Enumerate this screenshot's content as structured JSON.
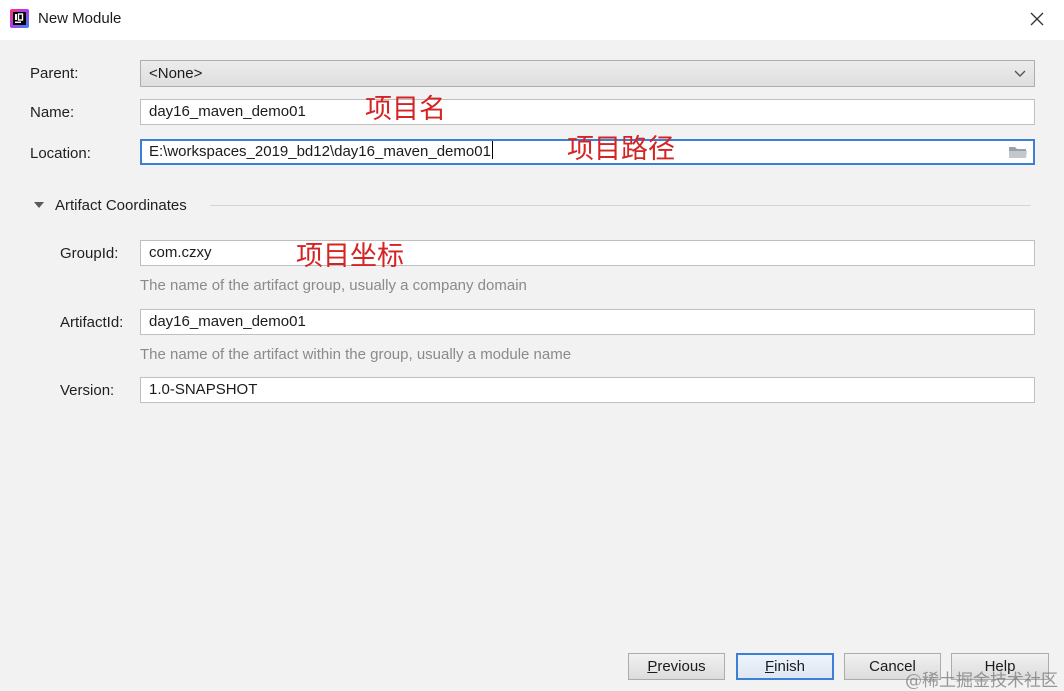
{
  "window": {
    "title": "New Module",
    "icon": "intellij-idea-icon",
    "close_icon": "close-icon"
  },
  "form": {
    "parent": {
      "label": "Parent:",
      "value": "<None>"
    },
    "name": {
      "label": "Name:",
      "value": "day16_maven_demo01"
    },
    "location": {
      "label": "Location:",
      "value": "E:\\workspaces_2019_bd12\\day16_maven_demo01",
      "browse_icon": "folder-icon"
    }
  },
  "artifact": {
    "section_title": "Artifact Coordinates",
    "expanded": true,
    "group_id": {
      "label": "GroupId:",
      "value": "com.czxy",
      "hint": "The name of the artifact group, usually a company domain"
    },
    "artifact_id": {
      "label": "ArtifactId:",
      "value": "day16_maven_demo01",
      "hint": "The name of the artifact within the group, usually a module name"
    },
    "version": {
      "label": "Version:",
      "value": "1.0-SNAPSHOT"
    }
  },
  "annotations": {
    "name_note": "项目名",
    "location_note": "项目路径",
    "group_note": "项目坐标"
  },
  "buttons": {
    "previous": {
      "mnemonic": "P",
      "rest": "revious"
    },
    "finish": {
      "mnemonic": "F",
      "rest": "inish"
    },
    "cancel": "Cancel",
    "help": "Help"
  },
  "watermark": "@稀土掘金技术社区",
  "colors": {
    "accent": "#3d7fd6",
    "annotation": "#d42424"
  }
}
